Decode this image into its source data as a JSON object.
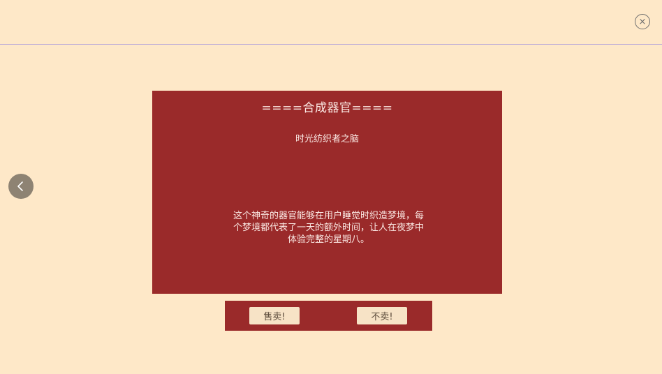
{
  "header": {
    "close_icon_glyph": "×"
  },
  "navigation": {
    "back_icon": "chevron-left-icon"
  },
  "card": {
    "title": "====合成器官====",
    "item_name": "时光纺织者之脑",
    "description": "这个神奇的器官能够在用户睡觉时织造梦境，每个梦境都代表了一天的额外时间，让人在夜梦中体验完整的星期八。"
  },
  "actions": {
    "sell_label": "售卖!",
    "no_sell_label": "不卖!"
  },
  "colors": {
    "background": "#fee8c8",
    "card": "#9a2a2a",
    "button": "#f7e3c6",
    "divider": "#b8a7d8"
  }
}
